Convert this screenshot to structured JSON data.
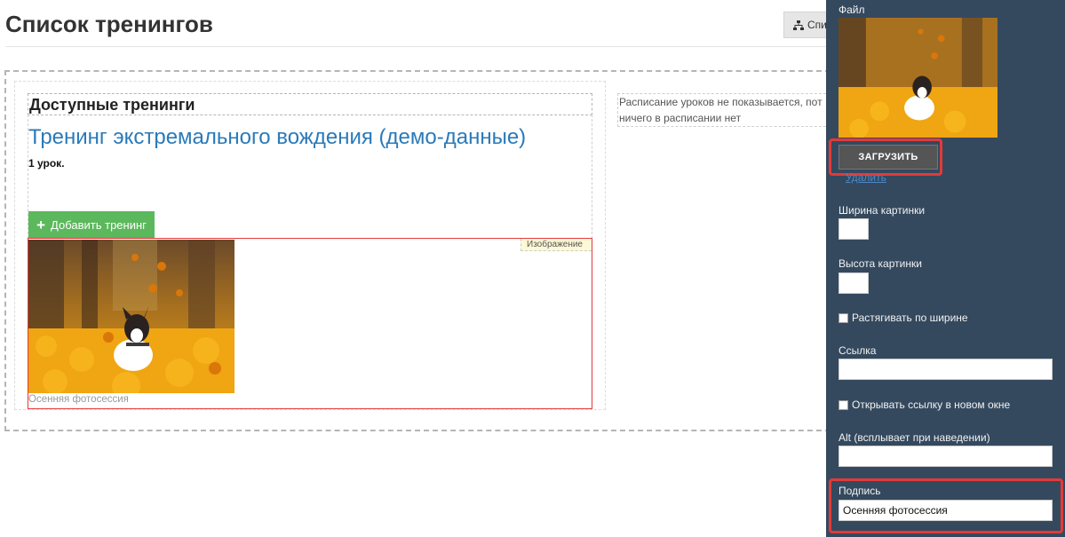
{
  "page": {
    "title": "Список тренингов",
    "top_button_label": "Спи"
  },
  "main": {
    "section_heading": "Доступные тренинги",
    "training_title": "Тренинг экстремального вождения (демо-данные)",
    "lessons": "1 урок.",
    "add_button": "Добавить тренинг",
    "image_block_tag": "Изображение",
    "image_caption": "Осенняя фотосессия",
    "schedule_line1": "Расписание уроков не показывается, пот",
    "schedule_line2": "ничего в расписании нет"
  },
  "panel": {
    "file_label": "Файл",
    "upload_button": "ЗАГРУЗИТЬ",
    "delete_link": "Удалить",
    "width_label": "Ширина картинки",
    "width_value": "",
    "height_label": "Высота картинки",
    "height_value": "",
    "stretch_label": "Растягивать по ширине",
    "stretch_checked": false,
    "link_label": "Ссылка",
    "link_value": "",
    "new_window_label": "Открывать ссылку в новом окне",
    "new_window_checked": false,
    "alt_label": "Alt (всплывает при наведении)",
    "alt_value": "",
    "caption_label": "Подпись",
    "caption_value": "Осенняя фотосессия"
  },
  "colors": {
    "panel_bg": "#34495e",
    "link_blue": "#2a7ab9",
    "add_green": "#5cb85c",
    "highlight_red": "#e23a3a"
  },
  "icons": {
    "top_button_icon": "sitemap-icon",
    "add_icon": "plus-icon"
  }
}
